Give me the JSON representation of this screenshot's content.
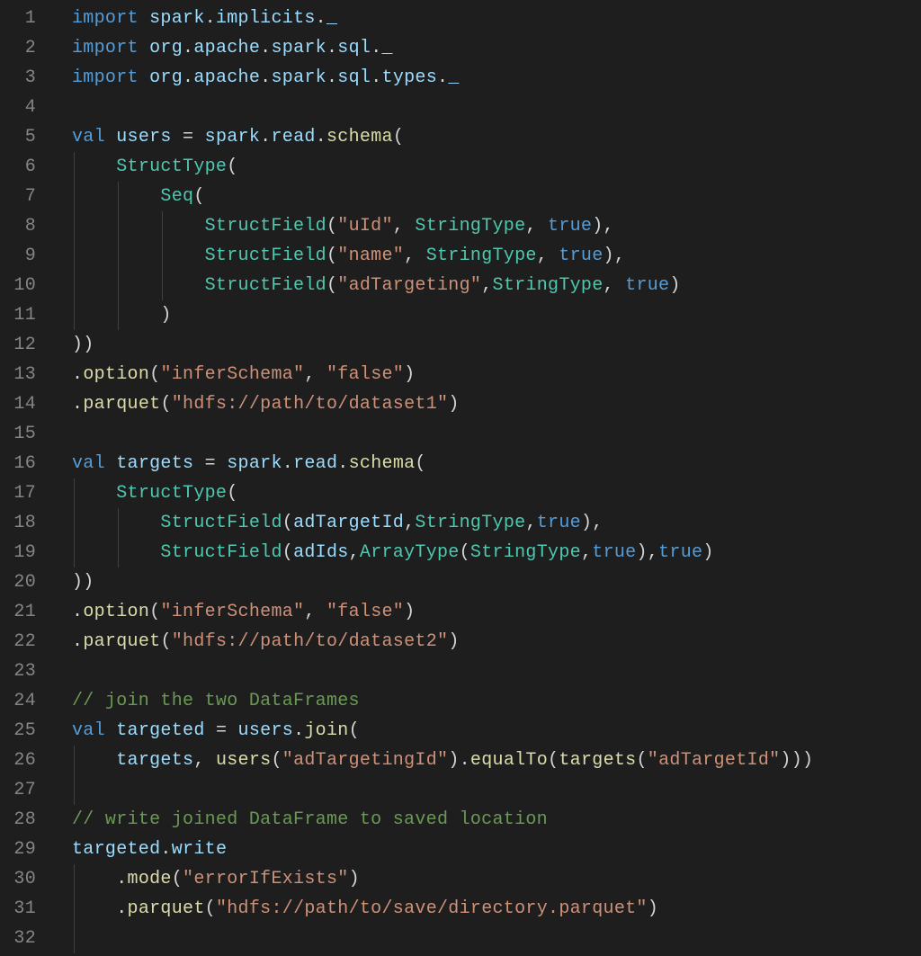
{
  "lines": 32,
  "code": [
    [
      {
        "c": "kw",
        "t": "import"
      },
      {
        "c": "pun",
        "t": " "
      },
      {
        "c": "var",
        "t": "spark"
      },
      {
        "c": "pun",
        "t": "."
      },
      {
        "c": "var",
        "t": "implicits"
      },
      {
        "c": "pun",
        "t": "."
      },
      {
        "c": "var",
        "t": "_"
      }
    ],
    [
      {
        "c": "kw",
        "t": "import"
      },
      {
        "c": "pun",
        "t": " "
      },
      {
        "c": "var",
        "t": "org"
      },
      {
        "c": "pun",
        "t": "."
      },
      {
        "c": "var",
        "t": "apache"
      },
      {
        "c": "pun",
        "t": "."
      },
      {
        "c": "var",
        "t": "spark"
      },
      {
        "c": "pun",
        "t": "."
      },
      {
        "c": "var",
        "t": "sql"
      },
      {
        "c": "pun",
        "t": "."
      },
      {
        "c": "var",
        "t": "_"
      }
    ],
    [
      {
        "c": "kw",
        "t": "import"
      },
      {
        "c": "pun",
        "t": " "
      },
      {
        "c": "var",
        "t": "org"
      },
      {
        "c": "pun",
        "t": "."
      },
      {
        "c": "var",
        "t": "apache"
      },
      {
        "c": "pun",
        "t": "."
      },
      {
        "c": "var",
        "t": "spark"
      },
      {
        "c": "pun",
        "t": "."
      },
      {
        "c": "var",
        "t": "sql"
      },
      {
        "c": "pun",
        "t": "."
      },
      {
        "c": "var",
        "t": "types"
      },
      {
        "c": "pun",
        "t": "."
      },
      {
        "c": "var",
        "t": "_"
      }
    ],
    [],
    [
      {
        "c": "kw",
        "t": "val"
      },
      {
        "c": "pun",
        "t": " "
      },
      {
        "c": "var",
        "t": "users"
      },
      {
        "c": "pun",
        "t": " = "
      },
      {
        "c": "var",
        "t": "spark"
      },
      {
        "c": "pun",
        "t": "."
      },
      {
        "c": "var",
        "t": "read"
      },
      {
        "c": "pun",
        "t": "."
      },
      {
        "c": "fn",
        "t": "schema"
      },
      {
        "c": "pun",
        "t": "("
      }
    ],
    [
      {
        "c": "pun",
        "t": "    "
      },
      {
        "c": "type",
        "t": "StructType"
      },
      {
        "c": "pun",
        "t": "("
      }
    ],
    [
      {
        "c": "pun",
        "t": "        "
      },
      {
        "c": "type",
        "t": "Seq"
      },
      {
        "c": "pun",
        "t": "("
      }
    ],
    [
      {
        "c": "pun",
        "t": "            "
      },
      {
        "c": "type",
        "t": "StructField"
      },
      {
        "c": "pun",
        "t": "("
      },
      {
        "c": "str",
        "t": "\"uId\""
      },
      {
        "c": "pun",
        "t": ", "
      },
      {
        "c": "type",
        "t": "StringType"
      },
      {
        "c": "pun",
        "t": ", "
      },
      {
        "c": "btrue",
        "t": "true"
      },
      {
        "c": "pun",
        "t": "),"
      }
    ],
    [
      {
        "c": "pun",
        "t": "            "
      },
      {
        "c": "type",
        "t": "StructField"
      },
      {
        "c": "pun",
        "t": "("
      },
      {
        "c": "str",
        "t": "\"name\""
      },
      {
        "c": "pun",
        "t": ", "
      },
      {
        "c": "type",
        "t": "StringType"
      },
      {
        "c": "pun",
        "t": ", "
      },
      {
        "c": "btrue",
        "t": "true"
      },
      {
        "c": "pun",
        "t": "),"
      }
    ],
    [
      {
        "c": "pun",
        "t": "            "
      },
      {
        "c": "type",
        "t": "StructField"
      },
      {
        "c": "pun",
        "t": "("
      },
      {
        "c": "str",
        "t": "\"adTargeting\""
      },
      {
        "c": "pun",
        "t": ","
      },
      {
        "c": "type",
        "t": "StringType"
      },
      {
        "c": "pun",
        "t": ", "
      },
      {
        "c": "btrue",
        "t": "true"
      },
      {
        "c": "pun",
        "t": ")"
      }
    ],
    [
      {
        "c": "pun",
        "t": "        )"
      }
    ],
    [
      {
        "c": "pun",
        "t": "))"
      }
    ],
    [
      {
        "c": "pun",
        "t": "."
      },
      {
        "c": "fn",
        "t": "option"
      },
      {
        "c": "pun",
        "t": "("
      },
      {
        "c": "str",
        "t": "\"inferSchema\""
      },
      {
        "c": "pun",
        "t": ", "
      },
      {
        "c": "str",
        "t": "\"false\""
      },
      {
        "c": "pun",
        "t": ")"
      }
    ],
    [
      {
        "c": "pun",
        "t": "."
      },
      {
        "c": "fn",
        "t": "parquet"
      },
      {
        "c": "pun",
        "t": "("
      },
      {
        "c": "str",
        "t": "\"hdfs://path/to/dataset1\""
      },
      {
        "c": "pun",
        "t": ")"
      }
    ],
    [],
    [
      {
        "c": "kw",
        "t": "val"
      },
      {
        "c": "pun",
        "t": " "
      },
      {
        "c": "var",
        "t": "targets"
      },
      {
        "c": "pun",
        "t": " = "
      },
      {
        "c": "var",
        "t": "spark"
      },
      {
        "c": "pun",
        "t": "."
      },
      {
        "c": "var",
        "t": "read"
      },
      {
        "c": "pun",
        "t": "."
      },
      {
        "c": "fn",
        "t": "schema"
      },
      {
        "c": "pun",
        "t": "("
      }
    ],
    [
      {
        "c": "pun",
        "t": "    "
      },
      {
        "c": "type",
        "t": "StructType"
      },
      {
        "c": "pun",
        "t": "("
      }
    ],
    [
      {
        "c": "pun",
        "t": "        "
      },
      {
        "c": "type",
        "t": "StructField"
      },
      {
        "c": "pun",
        "t": "("
      },
      {
        "c": "var",
        "t": "adTargetId"
      },
      {
        "c": "pun",
        "t": ","
      },
      {
        "c": "type",
        "t": "StringType"
      },
      {
        "c": "pun",
        "t": ","
      },
      {
        "c": "btrue",
        "t": "true"
      },
      {
        "c": "pun",
        "t": "),"
      }
    ],
    [
      {
        "c": "pun",
        "t": "        "
      },
      {
        "c": "type",
        "t": "StructField"
      },
      {
        "c": "pun",
        "t": "("
      },
      {
        "c": "var",
        "t": "adIds"
      },
      {
        "c": "pun",
        "t": ","
      },
      {
        "c": "type",
        "t": "ArrayType"
      },
      {
        "c": "pun",
        "t": "("
      },
      {
        "c": "type",
        "t": "StringType"
      },
      {
        "c": "pun",
        "t": ","
      },
      {
        "c": "btrue",
        "t": "true"
      },
      {
        "c": "pun",
        "t": "),"
      },
      {
        "c": "btrue",
        "t": "true"
      },
      {
        "c": "pun",
        "t": ")"
      }
    ],
    [
      {
        "c": "pun",
        "t": "))"
      }
    ],
    [
      {
        "c": "pun",
        "t": "."
      },
      {
        "c": "fn",
        "t": "option"
      },
      {
        "c": "pun",
        "t": "("
      },
      {
        "c": "str",
        "t": "\"inferSchema\""
      },
      {
        "c": "pun",
        "t": ", "
      },
      {
        "c": "str",
        "t": "\"false\""
      },
      {
        "c": "pun",
        "t": ")"
      }
    ],
    [
      {
        "c": "pun",
        "t": "."
      },
      {
        "c": "fn",
        "t": "parquet"
      },
      {
        "c": "pun",
        "t": "("
      },
      {
        "c": "str",
        "t": "\"hdfs://path/to/dataset2\""
      },
      {
        "c": "pun",
        "t": ")"
      }
    ],
    [],
    [
      {
        "c": "cmt",
        "t": "// join the two DataFrames"
      }
    ],
    [
      {
        "c": "kw",
        "t": "val"
      },
      {
        "c": "pun",
        "t": " "
      },
      {
        "c": "var",
        "t": "targeted"
      },
      {
        "c": "pun",
        "t": " = "
      },
      {
        "c": "var",
        "t": "users"
      },
      {
        "c": "pun",
        "t": "."
      },
      {
        "c": "fn",
        "t": "join"
      },
      {
        "c": "pun",
        "t": "("
      }
    ],
    [
      {
        "c": "pun",
        "t": "    "
      },
      {
        "c": "var",
        "t": "targets"
      },
      {
        "c": "pun",
        "t": ", "
      },
      {
        "c": "fn",
        "t": "users"
      },
      {
        "c": "pun",
        "t": "("
      },
      {
        "c": "str",
        "t": "\"adTargetingId\""
      },
      {
        "c": "pun",
        "t": ")."
      },
      {
        "c": "fn",
        "t": "equalTo"
      },
      {
        "c": "pun",
        "t": "("
      },
      {
        "c": "fn",
        "t": "targets"
      },
      {
        "c": "pun",
        "t": "("
      },
      {
        "c": "str",
        "t": "\"adTargetId\""
      },
      {
        "c": "pun",
        "t": ")))"
      }
    ],
    [],
    [
      {
        "c": "cmt",
        "t": "// write joined DataFrame to saved location"
      }
    ],
    [
      {
        "c": "var",
        "t": "targeted"
      },
      {
        "c": "pun",
        "t": "."
      },
      {
        "c": "var",
        "t": "write"
      }
    ],
    [
      {
        "c": "pun",
        "t": "    ."
      },
      {
        "c": "fn",
        "t": "mode"
      },
      {
        "c": "pun",
        "t": "("
      },
      {
        "c": "str",
        "t": "\"errorIfExists\""
      },
      {
        "c": "pun",
        "t": ")"
      }
    ],
    [
      {
        "c": "pun",
        "t": "    ."
      },
      {
        "c": "fn",
        "t": "parquet"
      },
      {
        "c": "pun",
        "t": "("
      },
      {
        "c": "str",
        "t": "\"hdfs://path/to/save/directory.parquet\""
      },
      {
        "c": "pun",
        "t": ")"
      }
    ],
    []
  ],
  "guides": {
    "6": [
      1
    ],
    "7": [
      1,
      2
    ],
    "8": [
      1,
      2,
      3
    ],
    "9": [
      1,
      2,
      3
    ],
    "10": [
      1,
      2,
      3
    ],
    "11": [
      1,
      2
    ],
    "17": [
      1
    ],
    "18": [
      1,
      2
    ],
    "19": [
      1,
      2
    ],
    "26": [
      1
    ],
    "27": [
      1
    ],
    "30": [
      1
    ],
    "31": [
      1
    ],
    "32": [
      1
    ]
  }
}
